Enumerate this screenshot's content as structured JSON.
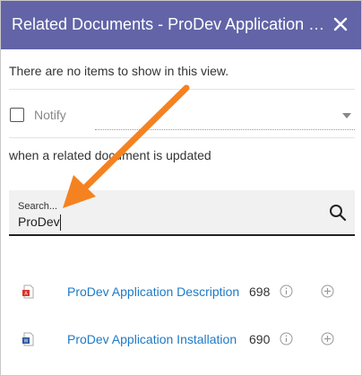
{
  "dialog": {
    "title": "Related Documents - ProDev Application Installation"
  },
  "list": {
    "empty_message": "There are no items to show in this view."
  },
  "notify": {
    "label": "Notify",
    "checked": false,
    "dropdown_value": "",
    "when_text": "when a related document is updated"
  },
  "search": {
    "label": "Search...",
    "value": "ProDev"
  },
  "results": [
    {
      "name": "ProDev Application Description",
      "number": "698",
      "file_type": "pdf",
      "icon": "pdf-file-icon",
      "color": "#d9342b"
    },
    {
      "name": "ProDev Application Installation",
      "number": "690",
      "file_type": "word",
      "icon": "word-file-icon",
      "color": "#2b579a"
    }
  ],
  "colors": {
    "header": "#6264a7",
    "link": "#1e7ac6",
    "annotation_arrow": "#f58220"
  },
  "icons": {
    "close": "close-icon",
    "search": "search-icon",
    "info": "info-icon",
    "add": "add-circle-icon",
    "dropdown": "chevron-down-icon"
  }
}
